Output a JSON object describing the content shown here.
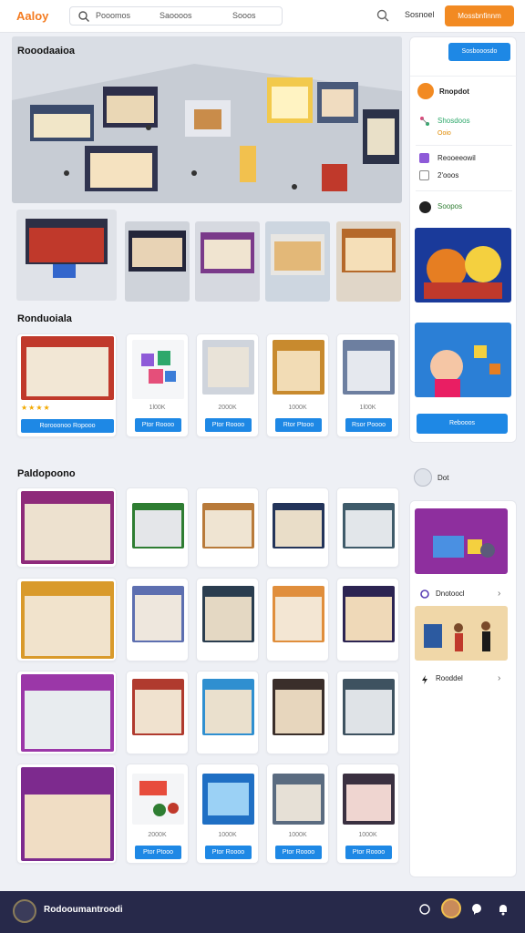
{
  "header": {
    "logo": "Aaloy",
    "search_items": [
      "Pooomos",
      "Saoooos",
      "Sooos"
    ],
    "link": "Sosnoel",
    "button": "Mossbnfinnm"
  },
  "hero_title": "Rooodaaioa",
  "section1": {
    "title": "Ronduoiala",
    "cards": [
      {
        "price": "",
        "button": "Rorooonoo Ropooo",
        "stars": "★★★★"
      },
      {
        "price": "1l00K",
        "button": "Ptor Roooo",
        "stars": ""
      },
      {
        "price": "2000K",
        "button": "Ptor Roooo",
        "stars": ""
      },
      {
        "price": "1000K",
        "button": "Rtor Ptooo",
        "stars": ""
      },
      {
        "price": "1l00K",
        "button": "Rsor Poooo",
        "stars": ""
      }
    ]
  },
  "section2": {
    "title": "Paldopoono",
    "grid_prices": [
      "2000K",
      "1000K",
      "1000K",
      "1000K"
    ],
    "grid_buttons": [
      "Ptor Ptooo",
      "Ptor Roooo",
      "Ptor Roooo",
      "Ptor Roooo"
    ]
  },
  "sidebar": {
    "top_button": "Sosbooosdo",
    "profile": "Rnopdot",
    "item1": "Shosdoos",
    "item1_sub": "Ooio",
    "item2": "Reooeeowil",
    "item2_sub": "2'ooos",
    "item3": "Soopos",
    "cta": "Rebooos"
  },
  "sidebar2": {
    "label": "Dot",
    "item1": "Dnotoocl",
    "item2": "Rooddel"
  },
  "footer": {
    "brand": "Rodooumantroodi"
  },
  "colors": {
    "accent": "#1e88e5",
    "brand_orange": "#f28a22",
    "footer_bg": "#27294a"
  }
}
